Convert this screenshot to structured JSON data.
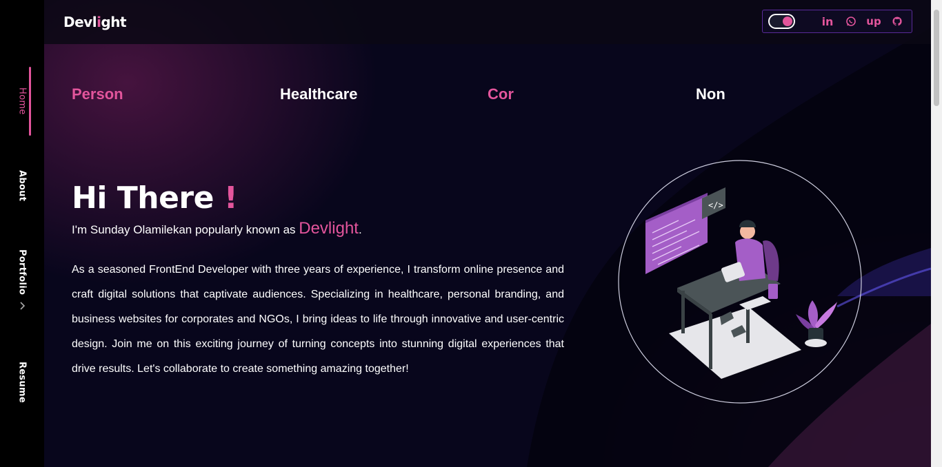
{
  "sidebar": {
    "items": [
      {
        "label": "Home"
      },
      {
        "label": "About"
      },
      {
        "label": "Portfolio"
      },
      {
        "label": "Resume"
      }
    ],
    "active": "Home"
  },
  "header": {
    "logo_prefix": "Devl",
    "logo_accent": "i",
    "logo_suffix": "ght",
    "social_icons": [
      "linkedin-icon",
      "whatsapp-icon",
      "upwork-icon",
      "github-icon"
    ],
    "linkedin_glyph": "in",
    "upwork_glyph": "up"
  },
  "tabs": [
    {
      "label": "Person",
      "color": "#e3559c"
    },
    {
      "label": "Healthcare",
      "color": "#ffffff"
    },
    {
      "label": "Cor",
      "color": "#e3559c"
    },
    {
      "label": "Non",
      "color": "#ffffff"
    }
  ],
  "hero": {
    "greeting": "Hi There",
    "exclaim": "!",
    "intro_prefix": "I'm Sunday Olamilekan popularly known as ",
    "intro_name": "Devlight",
    "intro_suffix": ".",
    "about": "As a seasoned FrontEnd Developer with three years of experience, I transform online presence and craft digital solutions that captivate audiences. Specializing in healthcare, personal branding, and business websites for corporates and NGOs, I bring ideas to life through innovative and user-centric design. Join me on this exciting journey of turning concepts into stunning digital experiences that drive results. Let's collaborate to create something amazing together!"
  },
  "colors": {
    "accent": "#e3559c",
    "sidebar_bg": "#000000",
    "page_bg": "#08061c",
    "outline": "#5a2a9a"
  }
}
